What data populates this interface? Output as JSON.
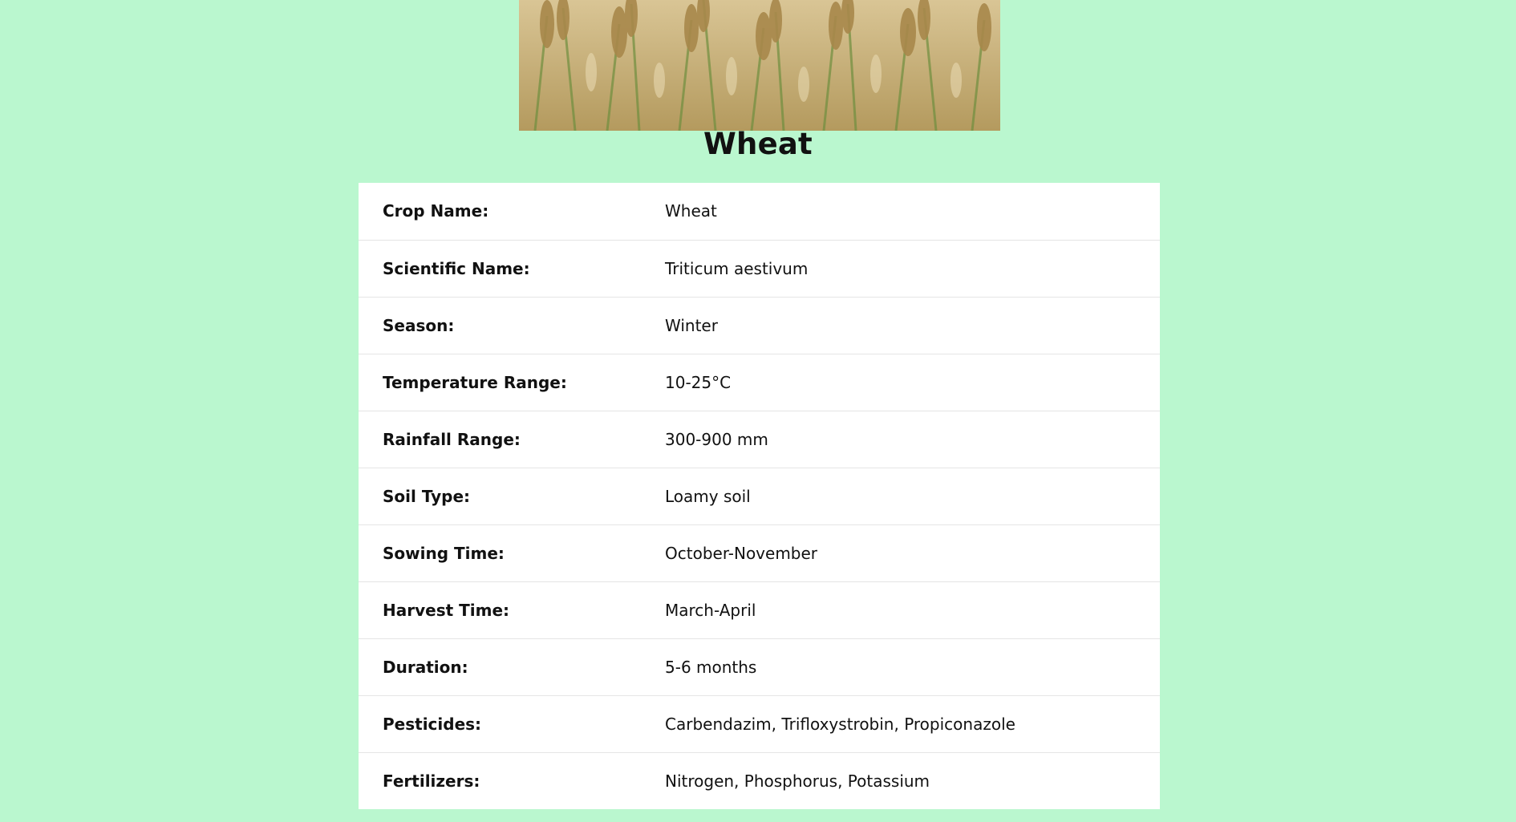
{
  "hero_image": {
    "alt": "Wheat field"
  },
  "crop": {
    "title": "Wheat"
  },
  "details": {
    "rows": [
      {
        "label": "Crop Name:",
        "value": "Wheat"
      },
      {
        "label": "Scientific Name:",
        "value": "Triticum aestivum"
      },
      {
        "label": "Season:",
        "value": "Winter"
      },
      {
        "label": "Temperature Range:",
        "value": "10-25°C"
      },
      {
        "label": "Rainfall Range:",
        "value": "300-900 mm"
      },
      {
        "label": "Soil Type:",
        "value": "Loamy soil"
      },
      {
        "label": "Sowing Time:",
        "value": "October-November"
      },
      {
        "label": "Harvest Time:",
        "value": "March-April"
      },
      {
        "label": "Duration:",
        "value": "5-6 months"
      },
      {
        "label": "Pesticides:",
        "value": "Carbendazim, Trifloxystrobin, Propiconazole"
      },
      {
        "label": "Fertilizers:",
        "value": "Nitrogen, Phosphorus, Potassium"
      }
    ]
  },
  "colors": {
    "page_background": "#baf7cf",
    "table_background": "#ffffff"
  }
}
